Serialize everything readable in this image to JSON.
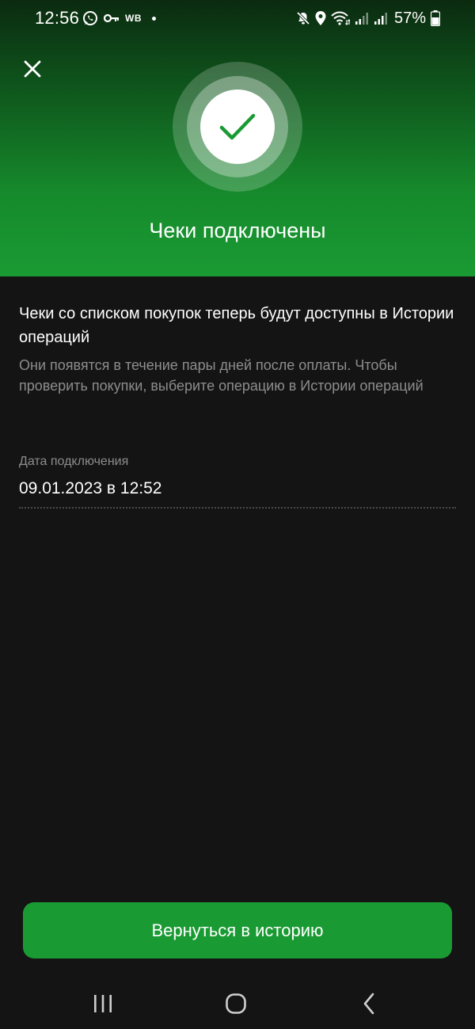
{
  "status_bar": {
    "time": "12:56",
    "carrier_badge": "WB",
    "battery": "57%"
  },
  "header": {
    "title": "Чеки подключены",
    "close_icon": "close-icon",
    "success_icon": "checkmark-icon"
  },
  "content": {
    "main_text": "Чеки со списком покупок теперь будут доступны в Истории операций",
    "sub_text": "Они появятся в течение пары дней после оплаты. Чтобы проверить покупки, выберите операцию в Истории операций",
    "date_label": "Дата подключения",
    "date_value": "09.01.2023 в 12:52"
  },
  "cta": {
    "label": "Вернуться в историю"
  },
  "colors": {
    "accent": "#1a9a33",
    "background": "#141414",
    "secondary_text": "#8d8d8d"
  }
}
